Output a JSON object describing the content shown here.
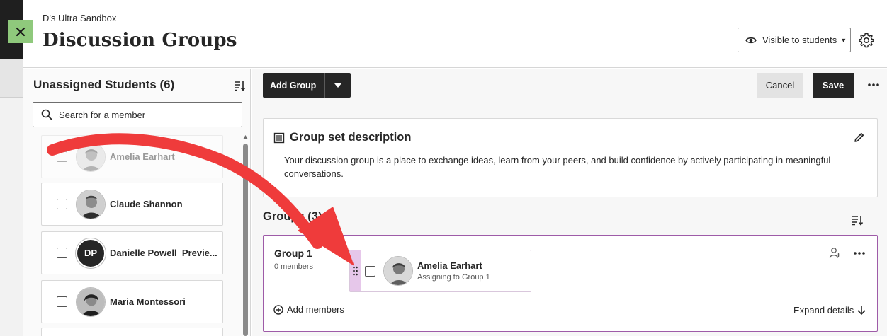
{
  "header": {
    "course_name": "D's Ultra Sandbox",
    "title": "Discussion Groups",
    "visibility_label": "Visible to students"
  },
  "unassigned": {
    "title": "Unassigned Students (6)",
    "search_placeholder": "Search for a member",
    "students": [
      {
        "name": "Amelia Earhart",
        "avatar": "photo"
      },
      {
        "name": "Claude Shannon",
        "avatar": "photo"
      },
      {
        "name": "Danielle Powell_Previe...",
        "avatar": "initials",
        "initials": "DP"
      },
      {
        "name": "Maria Montessori",
        "avatar": "photo"
      }
    ]
  },
  "toolbar": {
    "add_group_label": "Add Group",
    "cancel_label": "Cancel",
    "save_label": "Save"
  },
  "description": {
    "title": "Group set description",
    "text": "Your discussion group is a place to exchange ideas, learn from your peers, and build confidence by actively participating in meaningful conversations."
  },
  "groups": {
    "title": "Groups (3)",
    "items": [
      {
        "name": "Group 1",
        "member_count": "0 members",
        "dragging_member": {
          "name": "Amelia Earhart",
          "status": "Assigning to Group 1"
        },
        "add_members_label": "Add members",
        "expand_label": "Expand details"
      }
    ]
  },
  "colors": {
    "accent_purple": "#9e5ba8",
    "drag_handle": "#e6c7ea",
    "annotation_arrow": "#ef3b3b",
    "close_button": "#8fc97c",
    "primary_button": "#262626"
  }
}
